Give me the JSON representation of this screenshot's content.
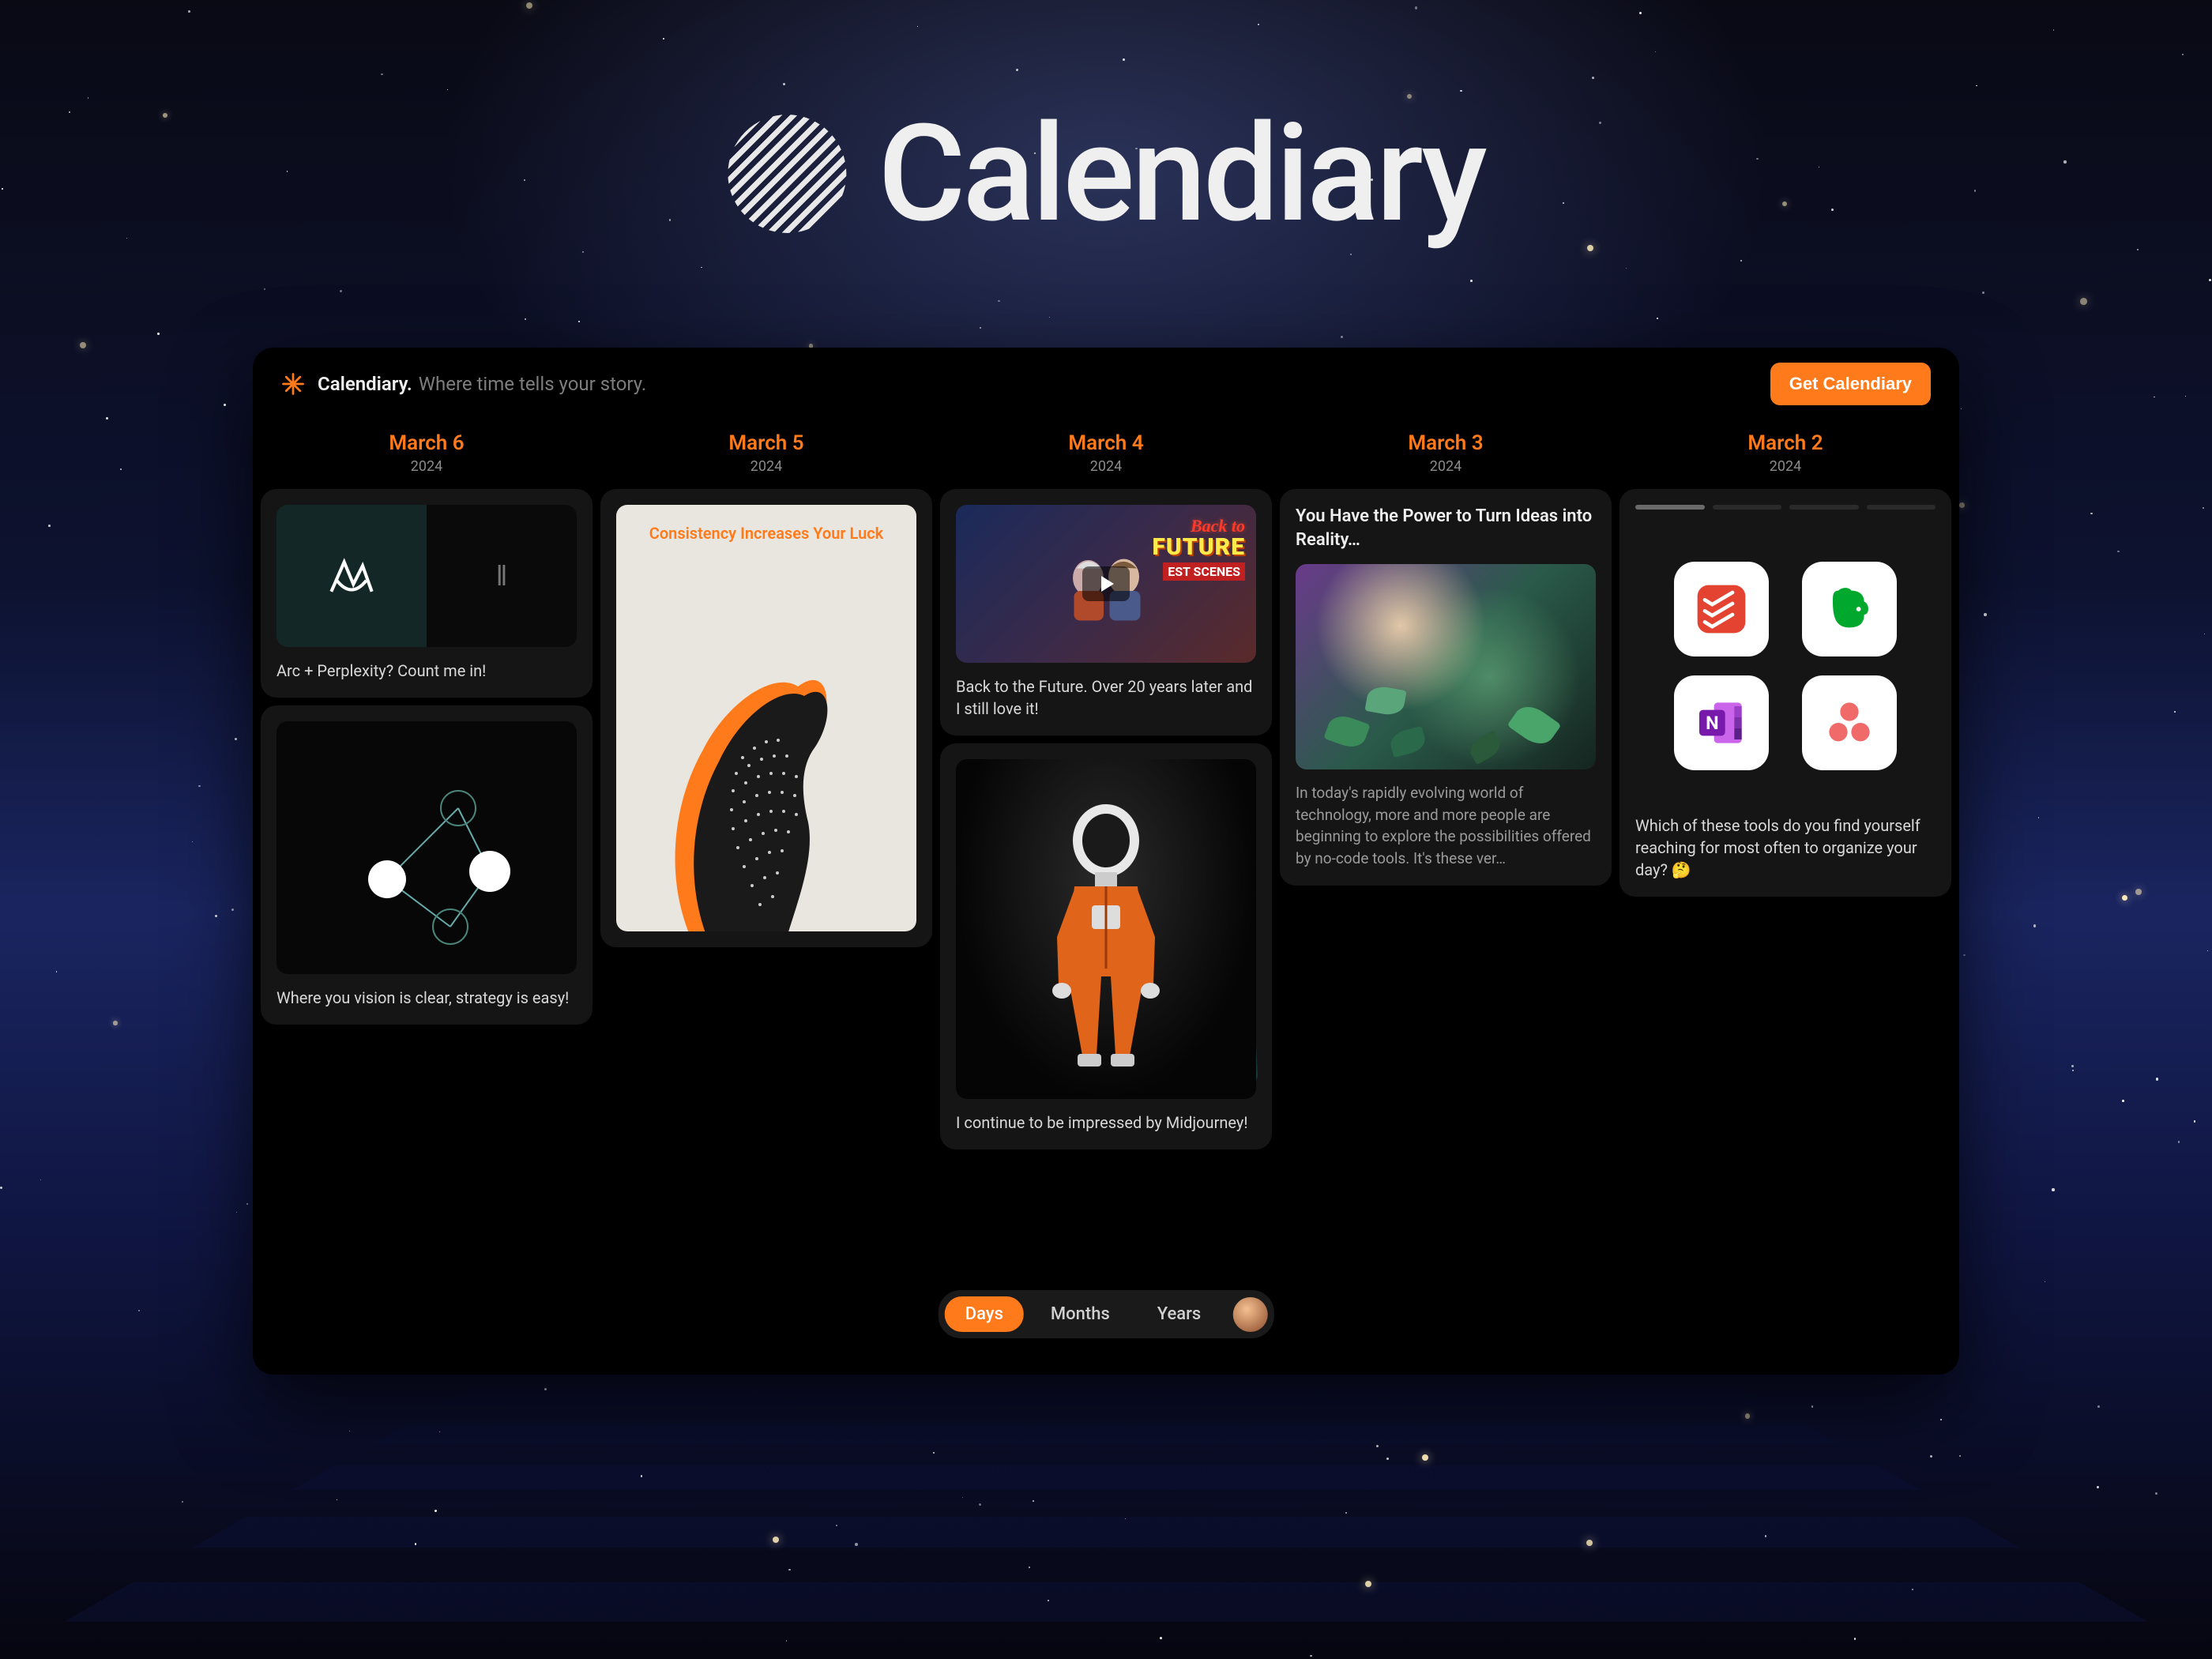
{
  "brand": {
    "name": "Calendiary",
    "tagline": "Where time tells your story."
  },
  "cta": {
    "label": "Get Calendiary"
  },
  "viewToggle": {
    "options": [
      "Days",
      "Months",
      "Years"
    ],
    "active": "Days"
  },
  "days": [
    {
      "date": "March 6",
      "year": "2024",
      "cards": [
        {
          "image_label": "Arc + Perplexity logos side by side",
          "caption": "Arc + Perplexity? Count me in!"
        },
        {
          "image_label": "Abstract network dots diagram",
          "caption": "Where you vision is clear, strategy is easy!"
        }
      ]
    },
    {
      "date": "March 5",
      "year": "2024",
      "cards": [
        {
          "image_label": "Consistency Increases Your Luck poster",
          "overlay_title": "Consistency Increases Your Luck"
        }
      ]
    },
    {
      "date": "March 4",
      "year": "2024",
      "cards": [
        {
          "image_label": "Back to the Future best scenes thumbnail",
          "badge_lines": [
            "Back to",
            "FUTURE",
            "EST SCENES"
          ],
          "caption": "Back to the Future. Over 20 years later and I still love it!"
        },
        {
          "image_label": "Midjourney astronaut in orange suit",
          "caption": "I continue to be impressed by Midjourney!"
        }
      ]
    },
    {
      "date": "March 3",
      "year": "2024",
      "cards": [
        {
          "title": "You Have the Power to Turn Ideas into Reality…",
          "image_label": "Glowing forest leaves illustration",
          "body": "In today's rapidly evolving world of technology, more and more people are beginning to explore the possibilities offered by no-code tools. It's these ver…"
        }
      ]
    },
    {
      "date": "March 2",
      "year": "2024",
      "cards": [
        {
          "type": "poll",
          "apps": [
            "Todoist",
            "Evernote",
            "OneNote",
            "Asana"
          ],
          "question": "Which of these tools do you find yourself reaching for most often to organize your day? 🤔"
        }
      ]
    }
  ]
}
